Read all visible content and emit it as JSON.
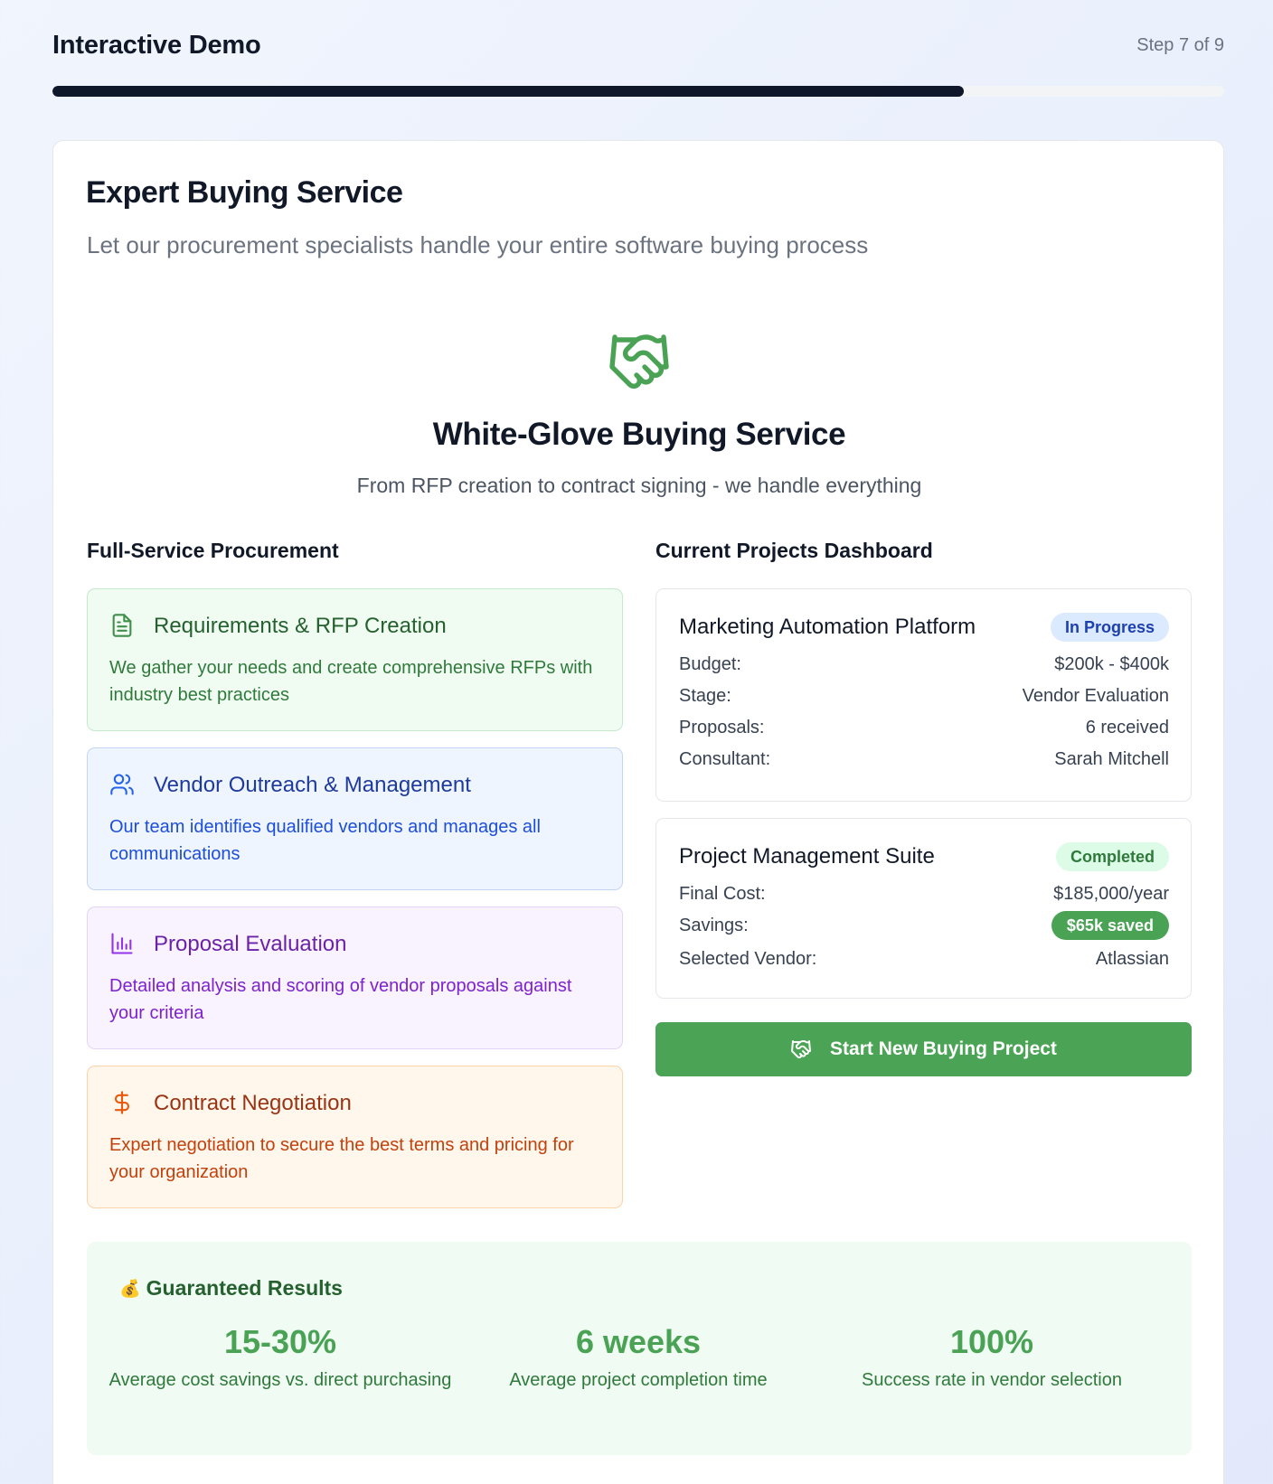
{
  "header": {
    "title": "Interactive Demo",
    "step": "Step 7 of 9",
    "progress_fraction": 0.778
  },
  "card": {
    "title": "Expert Buying Service",
    "subtitle": "Let our procurement specialists handle your entire software buying process"
  },
  "hero": {
    "icon": "handshake-icon",
    "title": "White-Glove Buying Service",
    "subtitle": "From RFP creation to contract signing - we handle everything"
  },
  "services": {
    "heading": "Full-Service Procurement",
    "items": [
      {
        "icon": "document-icon",
        "title": "Requirements & RFP Creation",
        "description": "We gather your needs and create comprehensive RFPs with industry best practices"
      },
      {
        "icon": "users-icon",
        "title": "Vendor Outreach & Management",
        "description": "Our team identifies qualified vendors and manages all communications"
      },
      {
        "icon": "bar-chart-icon",
        "title": "Proposal Evaluation",
        "description": "Detailed analysis and scoring of vendor proposals against your criteria"
      },
      {
        "icon": "dollar-icon",
        "title": "Contract Negotiation",
        "description": "Expert negotiation to secure the best terms and pricing for your organization"
      }
    ]
  },
  "dashboard": {
    "heading": "Current Projects Dashboard",
    "projects": [
      {
        "name": "Marketing Automation Platform",
        "status": "In Progress",
        "rows": [
          {
            "label": "Budget:",
            "value": "$200k - $400k"
          },
          {
            "label": "Stage:",
            "value": "Vendor Evaluation"
          },
          {
            "label": "Proposals:",
            "value": "6 received"
          },
          {
            "label": "Consultant:",
            "value": "Sarah Mitchell"
          }
        ]
      },
      {
        "name": "Project Management Suite",
        "status": "Completed",
        "rows": [
          {
            "label": "Final Cost:",
            "value": "$185,000/year"
          },
          {
            "label": "Savings:",
            "value": "$65k saved"
          },
          {
            "label": "Selected Vendor:",
            "value": "Atlassian"
          }
        ]
      }
    ],
    "cta_label": "Start New Buying Project"
  },
  "results": {
    "icon": "💰",
    "heading": "Guaranteed Results",
    "stats": [
      {
        "value": "15-30%",
        "label": "Average cost savings vs. direct purchasing"
      },
      {
        "value": "6 weeks",
        "label": "Average project completion time"
      },
      {
        "value": "100%",
        "label": "Success rate in vendor selection"
      }
    ]
  },
  "colors": {
    "accent_green": "#4aa255",
    "progress_fill": "#0f172a",
    "badge_in_progress_bg": "#dbeafe",
    "badge_completed_bg": "#dcfce7"
  }
}
